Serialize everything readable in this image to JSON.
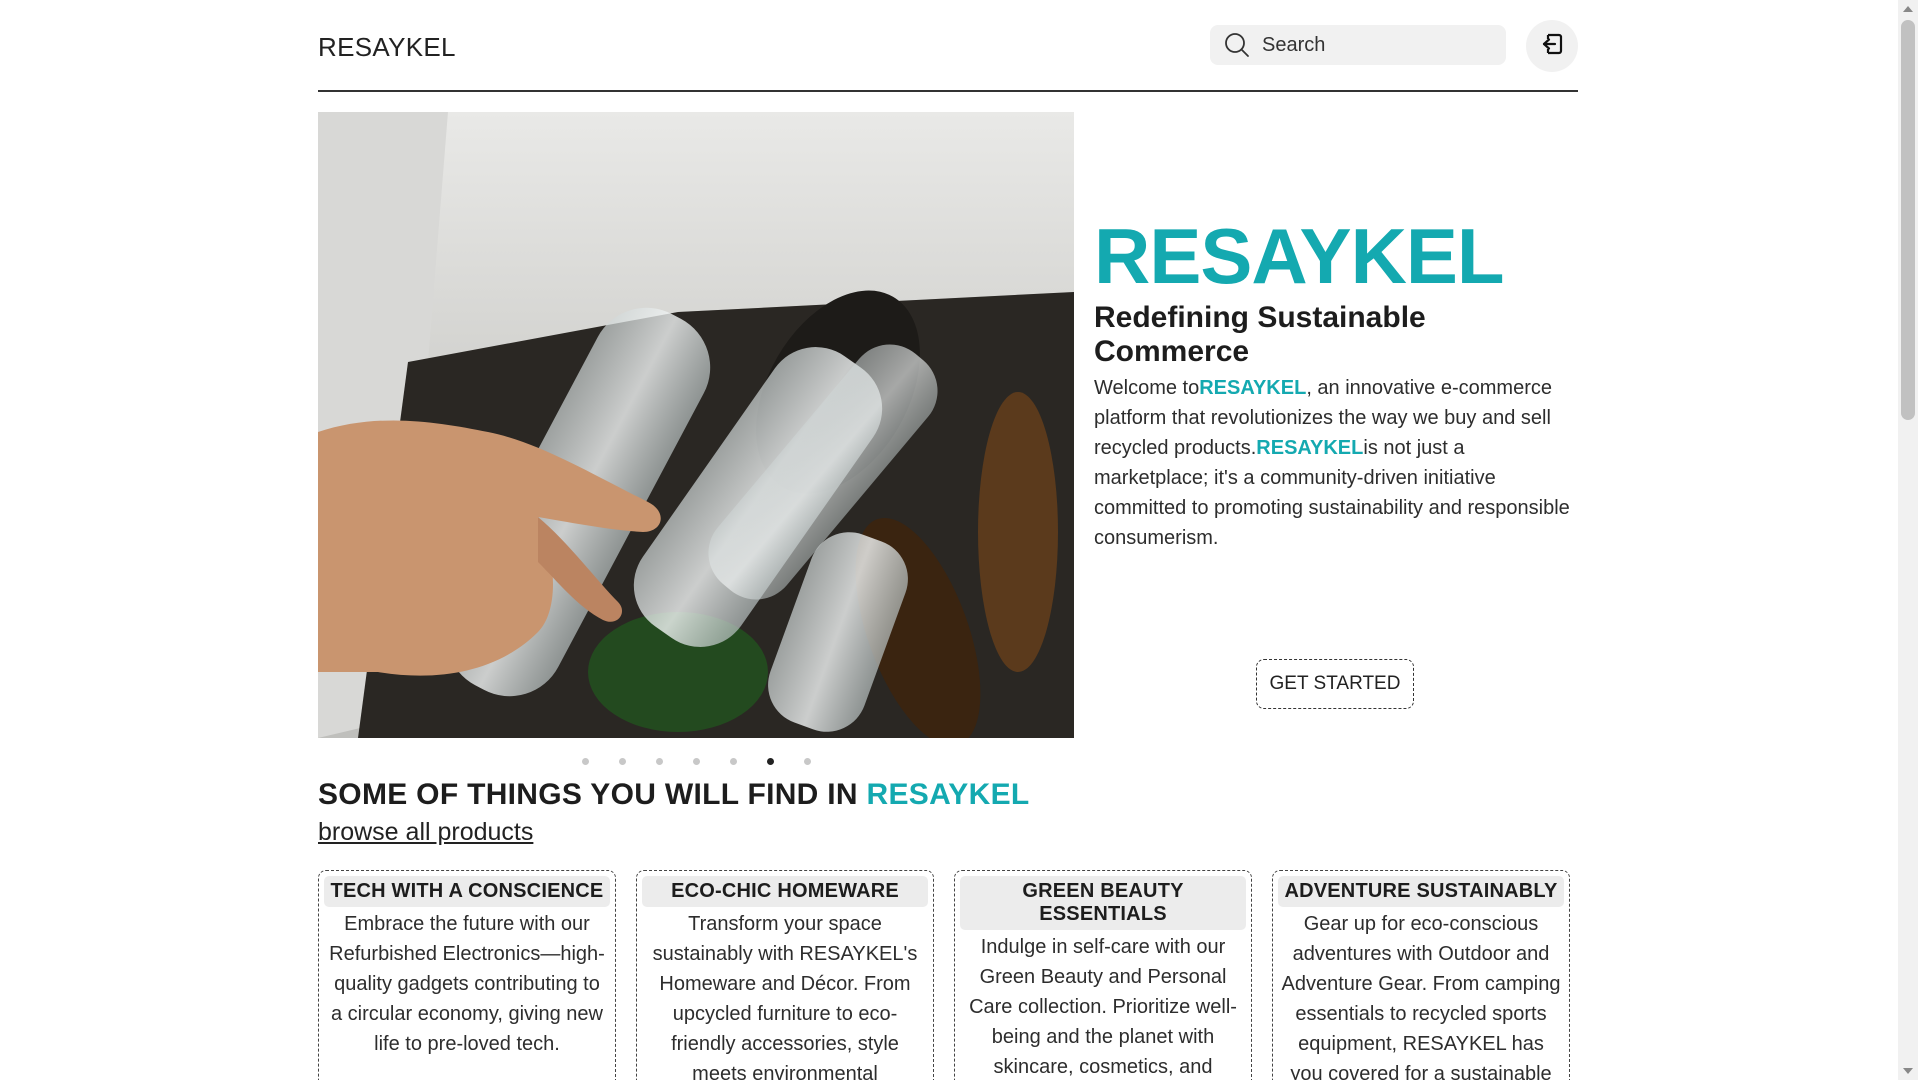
{
  "header": {
    "brand": "RESAYKEL",
    "search_placeholder": "Search",
    "search_icon": "search-icon",
    "logout_icon": "logout-icon"
  },
  "hero": {
    "title": "RESAYKEL",
    "subtitle": "Redefining Sustainable Commerce",
    "desc_welcome": "Welcome to",
    "desc_brand1": "RESAYKEL",
    "desc_part2": ", an innovative e-commerce platform that revolutionizes the way we buy and sell recycled products.",
    "desc_brand2": "RESAYKEL",
    "desc_part3": "is not just a marketplace; it's a community-driven initiative committed to promoting sustainability and responsible consumerism.",
    "cta_label": "GET STARTED",
    "carousel_count": 7,
    "carousel_active": 6
  },
  "section": {
    "title_prefix": "SOME OF THINGS YOU WILL FIND IN ",
    "title_highlight": "RESAYKEL",
    "browse_link": "browse all products"
  },
  "cards": [
    {
      "title": "TECH WITH A CONSCIENCE",
      "body": "Embrace the future with our Refurbished Electronics—high-quality gadgets contributing to a circular economy, giving new life to pre-loved tech."
    },
    {
      "title": "ECO-CHIC HOMEWARE",
      "body": "Transform your space sustainably with RESAYKEL's Homeware and Décor. From upcycled furniture to eco-friendly accessories, style meets environmental consciousness."
    },
    {
      "title": "GREEN BEAUTY ESSENTIALS",
      "body": "Indulge in self-care with our Green Beauty and Personal Care collection. Prioritize well-being and the planet with skincare, cosmetics, and grooming essentials."
    },
    {
      "title": "ADVENTURE SUSTAINABLY",
      "body": "Gear up for eco-conscious adventures with Outdoor and Adventure Gear. From camping essentials to recycled sports equipment, RESAYKEL has you covered for a sustainable"
    }
  ],
  "colors": {
    "accent": "#14a9b0",
    "text": "#212529",
    "surface": "#f1f1f1"
  }
}
